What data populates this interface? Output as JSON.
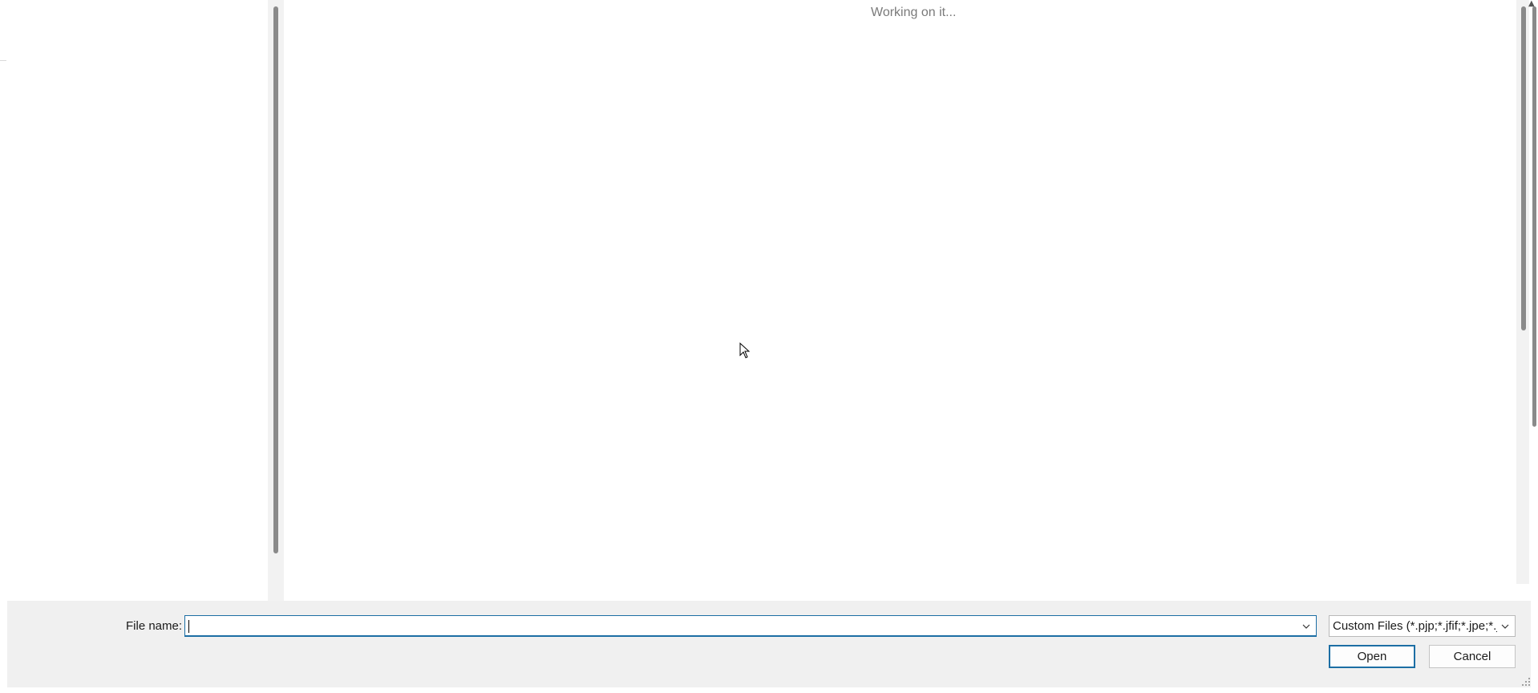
{
  "main": {
    "status_text": "Working on it..."
  },
  "footer": {
    "filename_label": "File name:",
    "filename_value": "",
    "filetype_selected": "Custom Files (*.pjp;*.jfif;*.jpe;*.jpg)",
    "open_label": "Open",
    "cancel_label": "Cancel"
  },
  "colors": {
    "accent": "#1c6ea4",
    "panel_background": "#f0f0f0",
    "status_text": "#7a7a7a"
  },
  "icons": {
    "filename_dropdown": "chevron-down-icon",
    "filetype_dropdown": "chevron-down-icon",
    "resize_grip": "resize-grip-icon",
    "mouse_pointer": "mouse-pointer-icon"
  }
}
